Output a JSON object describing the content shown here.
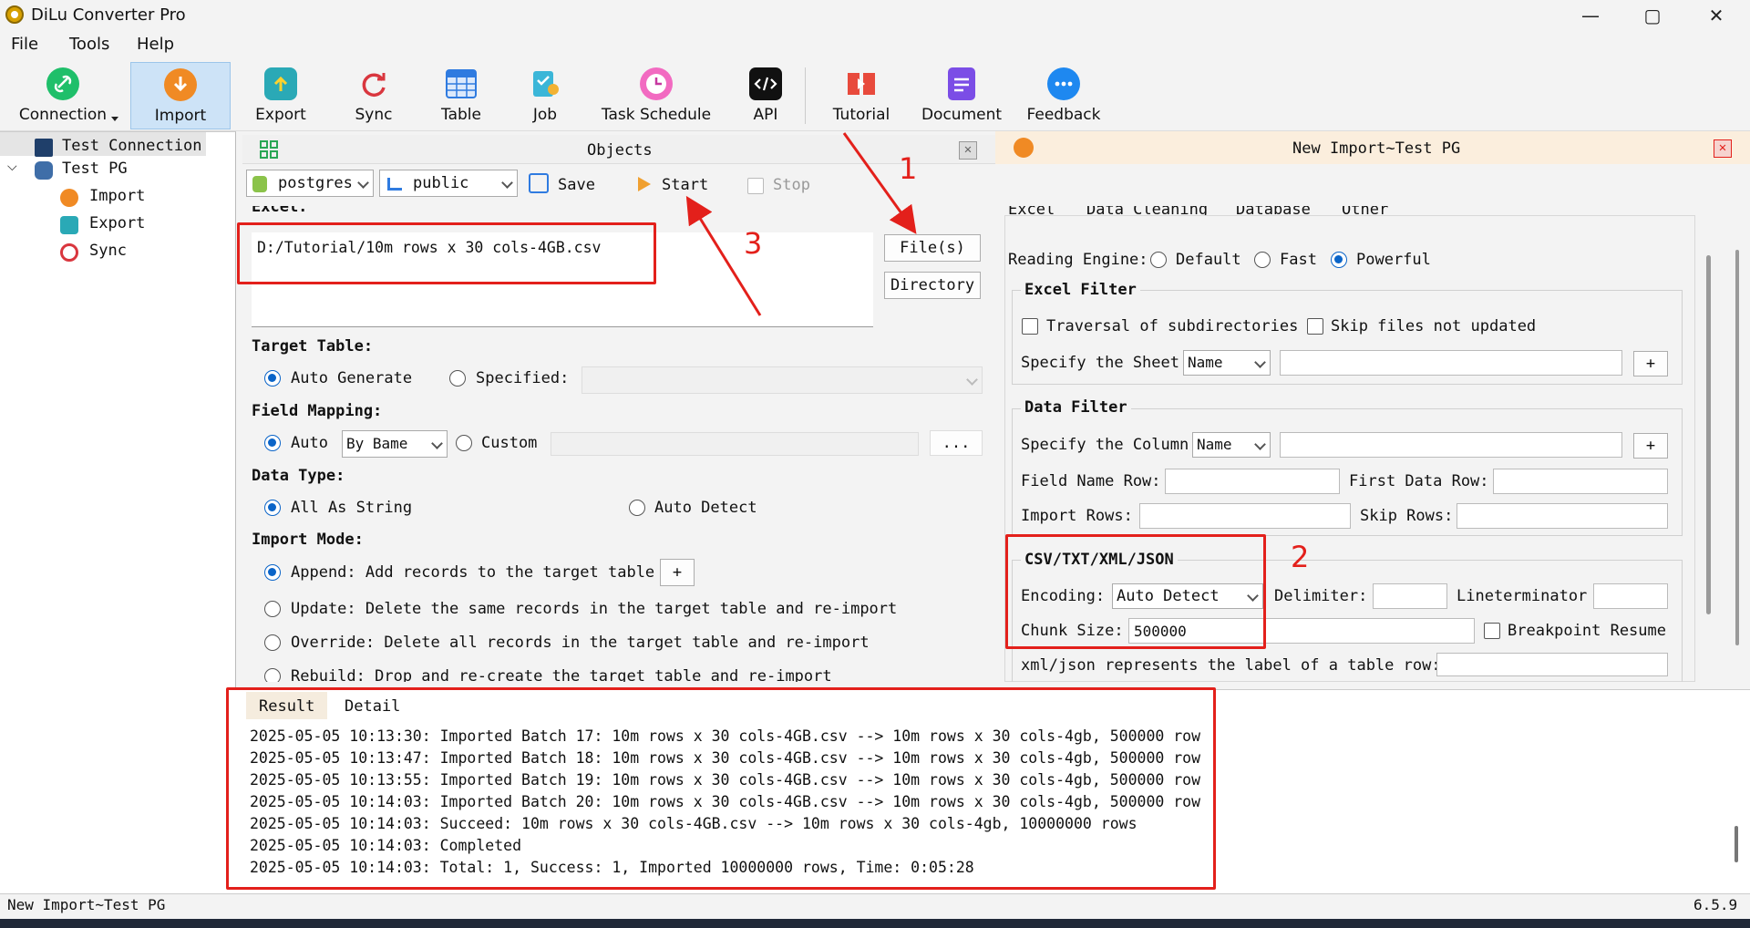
{
  "window": {
    "title": "DiLu Converter Pro",
    "minimize": "—",
    "maximize": "▢",
    "close": "✕"
  },
  "menu": [
    "File",
    "Tools",
    "Help"
  ],
  "toolbar": {
    "connection": "Connection",
    "import": "Import",
    "export": "Export",
    "sync": "Sync",
    "table": "Table",
    "job": "Job",
    "task_schedule": "Task Schedule",
    "api": "API",
    "tutorial": "Tutorial",
    "document": "Document",
    "feedback": "Feedback"
  },
  "tree": {
    "test_connection": "Test Connection",
    "test_pg": "Test PG",
    "import": "Import",
    "export": "Export",
    "sync": "Sync"
  },
  "objects": {
    "title": "Objects",
    "db_combo": "postgres",
    "schema_combo": "public",
    "save": "Save",
    "start": "Start",
    "stop": "Stop",
    "excel_label": "Excel:",
    "file_path": "D:/Tutorial/10m rows x 30 cols-4GB.csv",
    "files_btn": "File(s)",
    "directory_btn": "Directory",
    "target_table": "Target Table:",
    "auto_generate": "Auto Generate",
    "specified": "Specified:",
    "field_mapping": "Field Mapping:",
    "auto": "Auto",
    "by_name": "By Bame",
    "custom": "Custom",
    "ellipsis": "...",
    "data_type": "Data Type:",
    "all_as_string": "All As String",
    "auto_detect": "Auto Detect",
    "import_mode": "Import Mode:",
    "append": "Append: Add records to the target table",
    "plus": "+",
    "update": "Update: Delete the same records in the target table and re-import",
    "override": "Override: Delete all records in the target table and re-import",
    "rebuild": "Rebuild: Drop and re-create the target table and re-import"
  },
  "right": {
    "title": "New Import~Test PG",
    "tabs": [
      "Excel",
      "Data Cleaning",
      "Database",
      "Other"
    ],
    "reading_engine": "Reading Engine:",
    "default": "Default",
    "fast": "Fast",
    "powerful": "Powerful",
    "excel_filter": "Excel Filter",
    "traversal": "Traversal of subdirectories",
    "skip_files": "Skip files not updated",
    "specify_sheet": "Specify the Sheet",
    "sheet_combo": "Name",
    "data_filter": "Data Filter",
    "specify_column": "Specify the Column",
    "column_combo": "Name",
    "field_name_row": "Field Name Row:",
    "first_data_row": "First Data Row:",
    "import_rows": "Import Rows:",
    "skip_rows": "Skip Rows:",
    "csv_group": "CSV/TXT/XML/JSON",
    "encoding": "Encoding:",
    "encoding_value": "Auto Detect",
    "delimiter": "Delimiter:",
    "lineterminator": "Lineterminator",
    "chunk_size": "Chunk Size:",
    "chunk_value": "500000",
    "breakpoint": "Breakpoint Resume",
    "xml_label": "xml/json represents the label of a table row:",
    "plus": "+"
  },
  "result": {
    "tabs": [
      "Result",
      "Detail"
    ],
    "lines": [
      "2025-05-05 10:13:30: Imported Batch 17: 10m rows x 30 cols-4GB.csv --> 10m rows x 30 cols-4gb, 500000 row",
      "2025-05-05 10:13:47: Imported Batch 18: 10m rows x 30 cols-4GB.csv --> 10m rows x 30 cols-4gb, 500000 row",
      "2025-05-05 10:13:55: Imported Batch 19: 10m rows x 30 cols-4GB.csv --> 10m rows x 30 cols-4gb, 500000 row",
      "2025-05-05 10:14:03: Imported Batch 20: 10m rows x 30 cols-4GB.csv --> 10m rows x 30 cols-4gb, 500000 row",
      "2025-05-05 10:14:03: Succeed: 10m rows x 30 cols-4GB.csv --> 10m rows x 30 cols-4gb, 10000000 rows",
      "2025-05-05 10:14:03: Completed",
      "2025-05-05 10:14:03: Total: 1, Success: 1, Imported 10000000 rows, Time: 0:05:28"
    ]
  },
  "annotations": {
    "n1": "1",
    "n2": "2",
    "n3": "3"
  },
  "status": {
    "left": "New Import~Test PG",
    "version": "6.5.9"
  },
  "colors": {
    "accent": "#0a64c8",
    "annotation_red": "#e3201b",
    "header_tint": "#fbeedd"
  }
}
